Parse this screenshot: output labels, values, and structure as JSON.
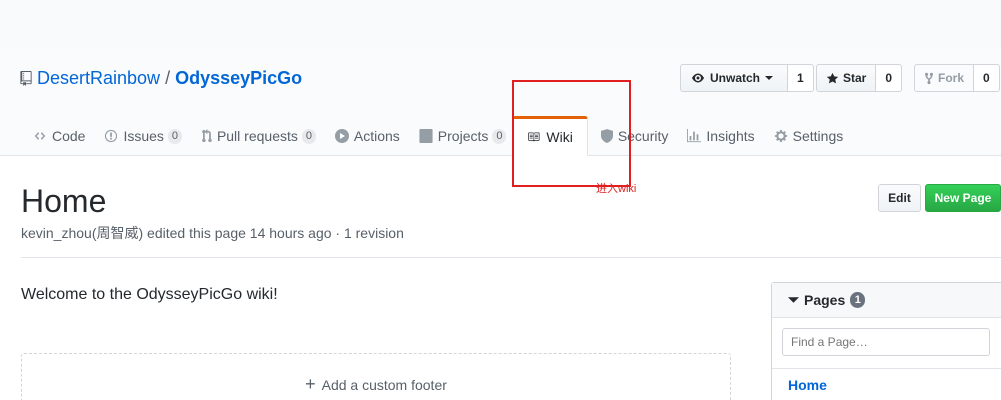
{
  "repo": {
    "owner": "DesertRainbow",
    "separator": "/",
    "name": "OdysseyPicGo"
  },
  "actions": {
    "watch": {
      "label": "Unwatch",
      "count": "1"
    },
    "star": {
      "label": "Star",
      "count": "0"
    },
    "fork": {
      "label": "Fork",
      "count": "0"
    }
  },
  "tabs": [
    {
      "label": "Code"
    },
    {
      "label": "Issues",
      "count": "0"
    },
    {
      "label": "Pull requests",
      "count": "0"
    },
    {
      "label": "Actions"
    },
    {
      "label": "Projects",
      "count": "0"
    },
    {
      "label": "Wiki",
      "selected": true
    },
    {
      "label": "Security"
    },
    {
      "label": "Insights"
    },
    {
      "label": "Settings"
    }
  ],
  "annotation": {
    "text": "进入wiki",
    "color": "#e02020"
  },
  "wiki": {
    "title": "Home",
    "meta": "kevin_zhou(周智威) edited this page 14 hours ago · 1 revision",
    "edit_label": "Edit",
    "new_page_label": "New Page",
    "welcome": "Welcome to the OdysseyPicGo wiki!",
    "footer_label": "Add a custom footer"
  },
  "sidebar": {
    "pages_label": "Pages",
    "pages_count": "1",
    "filter_placeholder": "Find a Page…",
    "pages": [
      "Home"
    ]
  },
  "colors": {
    "accent": "#0366d6",
    "selected_tab": "#e36209",
    "new_page": "#28a745"
  }
}
